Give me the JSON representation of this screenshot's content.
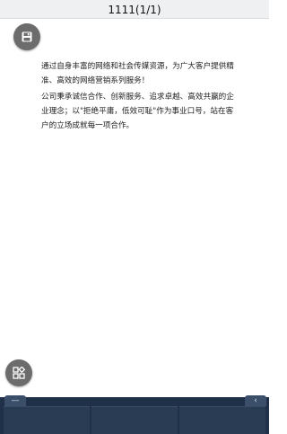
{
  "header": {
    "title": "1111(1/1)"
  },
  "floating_buttons": {
    "top": {
      "icon": "save-icon"
    },
    "bottom": {
      "icon": "apps-icon"
    }
  },
  "document": {
    "paragraphs": [
      "通过自身丰富的网络和社会传媒资源，为广大客户提供精准、高效的网络营销系列服务！",
      "公司秉承诚信合作、创新服务、追求卓越、高效共赢的企业理念；以\"拒绝平庸，低效可耻\"作为事业口号，站在客户的立场成就每一项合作。"
    ]
  },
  "bottom_bar": {
    "left_tab": "—",
    "right_tab": "‹",
    "panels": [
      "",
      "",
      ""
    ]
  },
  "colors": {
    "title_bar": "#eef0f2",
    "fab": "#6c6c6c",
    "bottom_bar": "#1f3048",
    "panel": "#2a3b54"
  }
}
